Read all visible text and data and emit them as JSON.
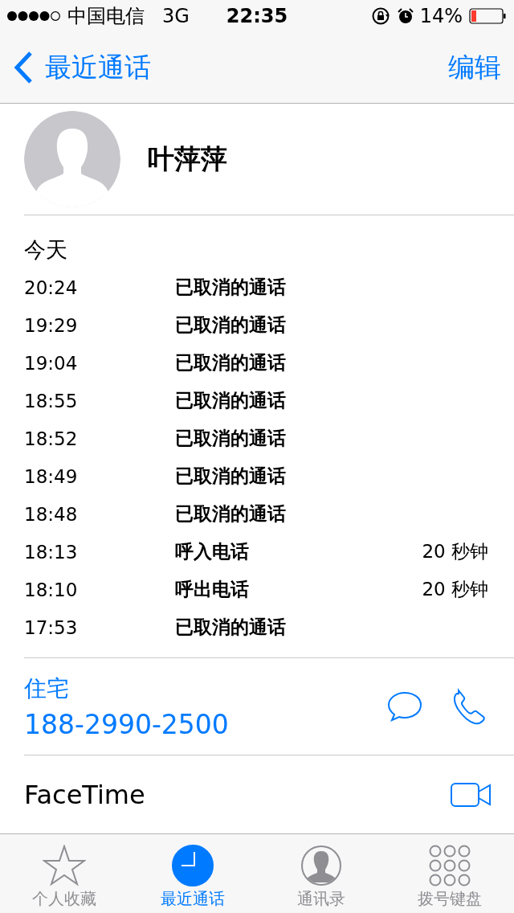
{
  "status_bar": {
    "carrier": "中国电信",
    "network": "3G",
    "time": "22:35",
    "battery_percent": "14%"
  },
  "nav": {
    "back": "最近通话",
    "action": "编辑"
  },
  "contact": {
    "name": "叶萍萍"
  },
  "calls_header": "今天",
  "calls": [
    {
      "time": "20:24",
      "type": "已取消的通话"
    },
    {
      "time": "19:29",
      "type": "已取消的通话"
    },
    {
      "time": "19:04",
      "type": "已取消的通话"
    },
    {
      "time": "18:55",
      "type": "已取消的通话"
    },
    {
      "time": "18:52",
      "type": "已取消的通话"
    },
    {
      "time": "18:49",
      "type": "已取消的通话"
    },
    {
      "time": "18:48",
      "type": "已取消的通话"
    },
    {
      "time": "18:13",
      "type": "呼入电话",
      "duration": "20 秒钟"
    },
    {
      "time": "18:10",
      "type": "呼出电话",
      "duration": "20 秒钟"
    },
    {
      "time": "17:53",
      "type": "已取消的通话"
    }
  ],
  "phone": {
    "label": "住宅",
    "number": "188-2990-2500"
  },
  "facetime": {
    "label": "FaceTime"
  },
  "tabs": [
    {
      "label": "个人收藏",
      "kind": "favorites",
      "selected": false
    },
    {
      "label": "最近通话",
      "kind": "recents",
      "selected": true
    },
    {
      "label": "通讯录",
      "kind": "contacts",
      "selected": false
    },
    {
      "label": "拨号键盘",
      "kind": "keypad",
      "selected": false
    }
  ]
}
